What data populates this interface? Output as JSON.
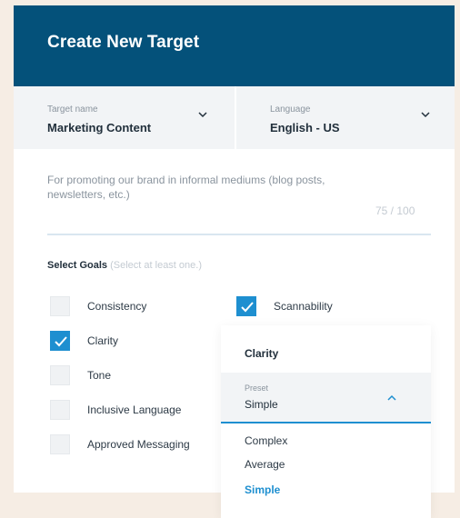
{
  "header": {
    "title": "Create New Target"
  },
  "target_name": {
    "label": "Target name",
    "value": "Marketing Content"
  },
  "language": {
    "label": "Language",
    "value": "English - US"
  },
  "description": {
    "text": "For promoting our brand in informal mediums (blog posts, newsletters, etc.)",
    "counter": "75 / 100"
  },
  "goals": {
    "title": "Select Goals",
    "hint": "(Select at least one.)",
    "items": [
      {
        "label": "Consistency",
        "checked": false
      },
      {
        "label": "Clarity",
        "checked": true
      },
      {
        "label": "Tone",
        "checked": false
      },
      {
        "label": "Inclusive Language",
        "checked": false
      },
      {
        "label": "Approved Messaging",
        "checked": false
      },
      {
        "label": "Scannability",
        "checked": true
      }
    ]
  },
  "clarity_dropdown": {
    "title": "Clarity",
    "preset_label": "Preset",
    "preset_value": "Simple",
    "options": [
      {
        "label": "Complex",
        "selected": false
      },
      {
        "label": "Average",
        "selected": false
      },
      {
        "label": "Simple",
        "selected": true
      }
    ]
  },
  "colors": {
    "header_bg": "#04517a",
    "accent": "#1e8fd0",
    "page_bg": "#f6ede4"
  }
}
